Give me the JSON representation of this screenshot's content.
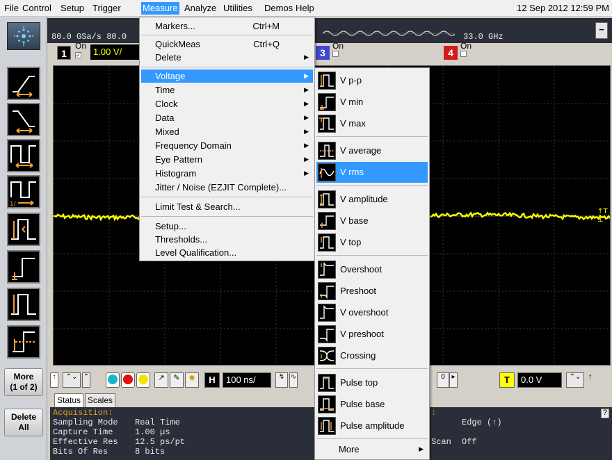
{
  "menubar": {
    "items": [
      "File",
      "Control",
      "Setup",
      "Trigger",
      "Measure",
      "Analyze",
      "Utilities",
      "Demos",
      "Help"
    ],
    "datetime": "12 Sep 2012 12:59 PM"
  },
  "header": {
    "sample_rate": "80.0 GSa/s  80.0",
    "bandwidth": "33.0 GHz",
    "minimize": "−",
    "ch1": {
      "num": "1",
      "on": "On",
      "scale": "1.00 V/"
    },
    "ch3": {
      "num": "3",
      "on": "On"
    },
    "ch4": {
      "num": "4",
      "on": "On"
    },
    "colors": {
      "ch1": "#ffff00",
      "ch3": "#3f48cc",
      "ch4": "#d01c1c"
    }
  },
  "left_rail": {
    "more": [
      "More",
      "(1 of 2)"
    ],
    "delete_all": [
      "Delete",
      "All"
    ]
  },
  "measure_menu": {
    "items": [
      {
        "label": "Markers...",
        "shortcut": "Ctrl+M"
      },
      {
        "label": "QuickMeas",
        "shortcut": "Ctrl+Q"
      },
      {
        "label": "Delete",
        "sub": true
      },
      {
        "label": "Voltage",
        "sub": true,
        "active": true
      },
      {
        "label": "Time",
        "sub": true
      },
      {
        "label": "Clock",
        "sub": true
      },
      {
        "label": "Data",
        "sub": true
      },
      {
        "label": "Mixed",
        "sub": true
      },
      {
        "label": "Frequency Domain",
        "sub": true
      },
      {
        "label": "Eye Pattern",
        "sub": true
      },
      {
        "label": "Histogram",
        "sub": true
      },
      {
        "label": "Jitter / Noise (EZJIT Complete)..."
      },
      {
        "label": "Limit Test & Search..."
      },
      {
        "label": "Setup..."
      },
      {
        "label": "Thresholds..."
      },
      {
        "label": "Level Qualification..."
      }
    ]
  },
  "voltage_submenu": {
    "items": [
      "V p-p",
      "V min",
      "V max",
      "V average",
      "V rms",
      "V amplitude",
      "V base",
      "V top",
      "Overshoot",
      "Preshoot",
      "V overshoot",
      "V preshoot",
      "Crossing",
      "Pulse top",
      "Pulse base",
      "Pulse amplitude"
    ],
    "highlighted": "V rms",
    "more": "More"
  },
  "controls": {
    "timebase": "100 ns/",
    "trigger_level": "0.0 V",
    "trigger_ch": "T",
    "h_label": "H"
  },
  "tabs": [
    "Status",
    "Scales"
  ],
  "status": {
    "header": "Acquisition:",
    "rows": [
      {
        "label": "Sampling Mode",
        "value": "Real Time"
      },
      {
        "label": "Capture Time",
        "value": "1.00 µs"
      },
      {
        "label": "Effective Res",
        "value": "12.5 ps/pt"
      },
      {
        "label": "Bits Of Res",
        "value": "8 bits"
      }
    ],
    "right_colon": ":",
    "edge": "Edge (↑)",
    "scan_label": "Scan",
    "scan_value": "Off",
    "help": "?"
  }
}
